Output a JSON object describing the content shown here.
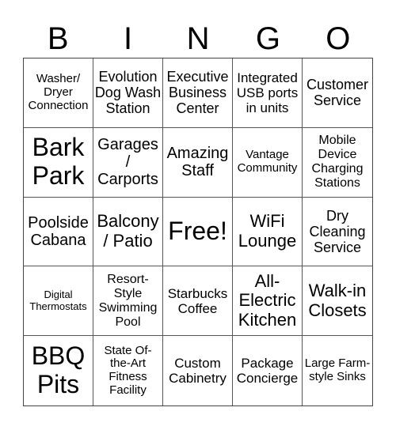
{
  "header": [
    "B",
    "I",
    "N",
    "G",
    "O"
  ],
  "cells": [
    "Washer/ Dryer Connection",
    "Evolution Dog Wash Station",
    "Executive Business Center",
    "Integrated USB ports in units",
    "Customer Service",
    "Bark Park",
    "Garages / Carports",
    "Amazing Staff",
    "Vantage Community",
    "Mobile Device Charging Stations",
    "Poolside Cabana",
    "Balcony / Patio",
    "Free!",
    "WiFi Lounge",
    "Dry Cleaning Service",
    "Digital Thermostats",
    "Resort-Style Swimming Pool",
    "Starbucks Coffee",
    "All-Electric Kitchen",
    "Walk-in Closets",
    "BBQ Pits",
    "State Of-the-Art Fitness Facility",
    "Custom Cabinetry",
    "Package Concierge",
    "Large Farm-style Sinks"
  ]
}
